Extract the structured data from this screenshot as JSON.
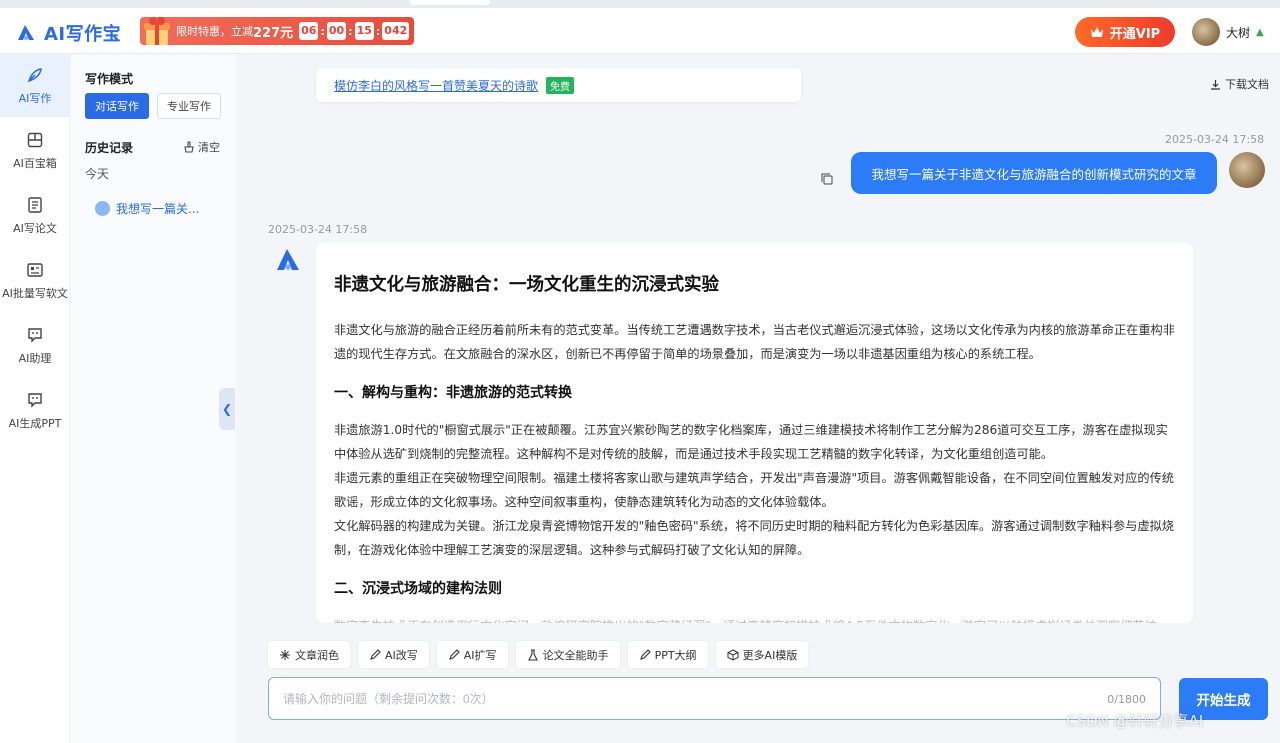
{
  "header": {
    "logo_text": "AI写作宝",
    "promo": {
      "label": "限时特惠，立减",
      "price": "227元",
      "t1": "06",
      "t2": "00",
      "t3": "15",
      "t4": "042"
    },
    "vip_label": "开通VIP",
    "user_name": "大树"
  },
  "nav": {
    "items": [
      {
        "label": "AI写作",
        "icon": "quill-icon"
      },
      {
        "label": "AI百宝箱",
        "icon": "toolbox-icon"
      },
      {
        "label": "AI写论文",
        "icon": "document-icon"
      },
      {
        "label": "AI批量写软文",
        "icon": "batch-icon"
      },
      {
        "label": "AI助理",
        "icon": "chat-bubble-icon"
      },
      {
        "label": "AI生成PPT",
        "icon": "ppt-icon"
      }
    ]
  },
  "history": {
    "mode_title": "写作模式",
    "mode_chat": "对话写作",
    "mode_pro": "专业写作",
    "history_title": "历史记录",
    "clear_label": "清空",
    "today": "今天",
    "item": "我想写一篇关..."
  },
  "chat": {
    "suggestion": "模仿李白的风格写一首赞美夏天的诗歌",
    "free": "免费",
    "download": "下载文档",
    "user_time": "2025-03-24 17:58",
    "user_message": "我想写一篇关于非遗文化与旅游融合的创新模式研究的文章",
    "bot_time": "2025-03-24 17:58",
    "article": {
      "title": "非遗文化与旅游融合：一场文化重生的沉浸式实验",
      "intro": "非遗文化与旅游的融合正经历着前所未有的范式变革。当传统工艺遭遇数字技术，当古老仪式邂逅沉浸式体验，这场以文化传承为内核的旅游革命正在重构非遗的现代生存方式。在文旅融合的深水区，创新已不再停留于简单的场景叠加，而是演变为一场以非遗基因重组为核心的系统工程。",
      "h1": "一、解构与重构：非遗旅游的范式转换",
      "p1": "非遗旅游1.0时代的\"橱窗式展示\"正在被颠覆。江苏宜兴紫砂陶艺的数字化档案库，通过三维建模技术将制作工艺分解为286道可交互工序，游客在虚拟现实中体验从选矿到烧制的完整流程。这种解构不是对传统的肢解，而是通过技术手段实现工艺精髓的数字化转译，为文化重组创造可能。",
      "p2": "非遗元素的重组正在突破物理空间限制。福建土楼将客家山歌与建筑声学结合，开发出\"声音漫游\"项目。游客佩戴智能设备，在不同空间位置触发对应的传统歌谣，形成立体的文化叙事场。这种空间叙事重构，使静态建筑转化为动态的文化体验载体。",
      "p3": "文化解码器的构建成为关键。浙江龙泉青瓷博物馆开发的\"釉色密码\"系统，将不同历史时期的釉料配方转化为色彩基因库。游客通过调制数字釉料参与虚拟烧制，在游戏化体验中理解工艺演变的深层逻辑。这种参与式解码打破了文化认知的屏障。",
      "h2": "二、沉浸式场域的建构法则",
      "p4": "数字孪生技术正在创造平行文化空间。敦煌研究院推出的\"数字藏经洞\"，通过高精度扫描技术将4.5万件文物数字化，游客可以触摸虚拟经卷并观察细节纹"
    }
  },
  "tools": [
    "文章润色",
    "AI改写",
    "AI扩写",
    "论文全能助手",
    "PPT大纲",
    "更多AI模版"
  ],
  "input": {
    "placeholder": "请输入你的问题（剩余提问次数：0次）",
    "counter": "0/1800"
  },
  "generate_label": "开始生成",
  "watermark": "CSDN @轩轩分享AI",
  "colors": {
    "accent": "#2b6be6",
    "bubble": "#2b7cf6",
    "vip": "#ee3b2c",
    "free": "#27b35a"
  }
}
